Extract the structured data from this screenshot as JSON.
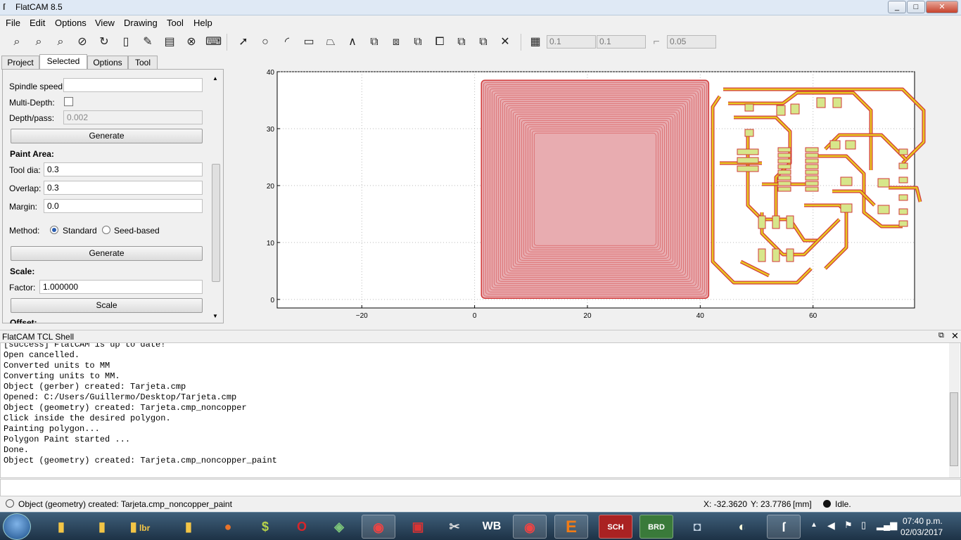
{
  "window": {
    "title": "FlatCAM 8.5",
    "minimize": "_",
    "maximize": "□",
    "close": "✕"
  },
  "menu": [
    "File",
    "Edit",
    "Options",
    "View",
    "Drawing",
    "Tool",
    "Help"
  ],
  "toolbar": {
    "grid_x": "0.1",
    "grid_y": "0.1",
    "snap_max": "0.05"
  },
  "tabs": [
    "Project",
    "Selected",
    "Options",
    "Tool"
  ],
  "selected_tab": "Selected",
  "panel": {
    "spindle_label": "Spindle speed:",
    "spindle_value": "",
    "multidepth_label": "Multi-Depth:",
    "depthpass_label": "Depth/pass:",
    "depthpass_value": "0.002",
    "generate1": "Generate",
    "paint_header": "Paint Area:",
    "tooldia_label": "Tool dia:",
    "tooldia_value": "0.3",
    "overlap_label": "Overlap:",
    "overlap_value": "0.3",
    "margin_label": "Margin:",
    "margin_value": "0.0",
    "method_label": "Method:",
    "method_standard": "Standard",
    "method_seed": "Seed-based",
    "generate2": "Generate",
    "scale_header": "Scale:",
    "factor_label": "Factor:",
    "factor_value": "1.000000",
    "scale_button": "Scale",
    "offset_header": "Offset:"
  },
  "plot": {
    "x_ticks": [
      "−20",
      "0",
      "20",
      "40",
      "60"
    ],
    "y_ticks": [
      "0",
      "10",
      "20",
      "30",
      "40"
    ],
    "x_range": [
      -35,
      78
    ],
    "y_range": [
      -1.5,
      40
    ]
  },
  "shell": {
    "title": "FlatCAM TCL Shell",
    "lines": [
      "[success] FlatCAM is up to date!",
      "Open cancelled.",
      "Converted units to MM",
      "Converting units to MM.",
      "Object (gerber) created: Tarjeta.cmp",
      "Opened: C:/Users/Guillermo/Desktop/Tarjeta.cmp",
      "Object (geometry) created: Tarjeta.cmp_noncopper",
      "Click inside the desired polygon.",
      "Painting polygon...",
      "Polygon Paint started ...",
      "Done.",
      "Object (geometry) created: Tarjeta.cmp_noncopper_paint"
    ]
  },
  "status": {
    "message": "Object (geometry) created: Tarjeta.cmp_noncopper_paint",
    "x": "X: -32.3620",
    "y": "Y: 23.7786",
    "units": "[mm]",
    "state": "Idle."
  },
  "taskbar": {
    "apps": [
      "folder",
      "folder",
      "folder",
      "lbr",
      "folder",
      "firefox",
      "s-app",
      "opera",
      "cube",
      "chrome",
      "flag-app",
      "paint-app",
      "wb-app",
      "chrome",
      "eagle",
      "SCH",
      "BRD",
      "camera",
      "palette",
      "flatcam"
    ],
    "time": "07:40 p.m.",
    "date": "02/03/2017"
  },
  "colors": {
    "board_fill": "#e8acb0",
    "trace_red": "#d23a3a",
    "trace_yellow": "#e8c820",
    "pad": "#d7e68a"
  }
}
